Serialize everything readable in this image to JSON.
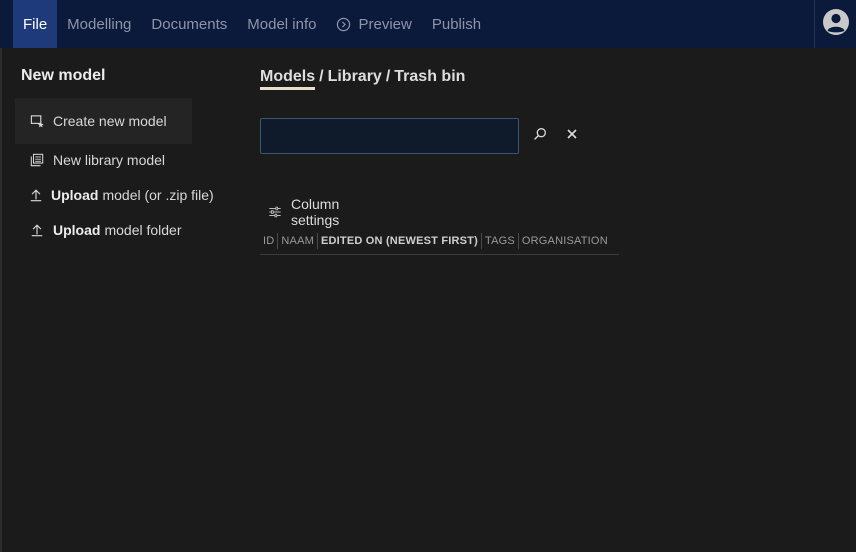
{
  "nav": {
    "items": [
      {
        "label": "File",
        "active": true
      },
      {
        "label": "Modelling"
      },
      {
        "label": "Documents"
      },
      {
        "label": "Model info"
      },
      {
        "label": "Preview",
        "icon": "play-circle-icon"
      },
      {
        "label": "Publish"
      }
    ],
    "user_icon": "user-avatar-icon"
  },
  "sidebar": {
    "title": "New model",
    "items": [
      {
        "bold": "",
        "text": "Create new model",
        "icon": "new-model-icon"
      },
      {
        "bold": "",
        "text": "New library model",
        "icon": "library-icon"
      },
      {
        "bold": "Upload",
        "text": "model (or .zip file)",
        "icon": "upload-icon"
      },
      {
        "bold": "Upload",
        "text": "model folder",
        "icon": "upload-icon"
      }
    ]
  },
  "main": {
    "breadcrumb": {
      "active": "Models",
      "sep": "/",
      "library": "Library",
      "trash": "Trash bin"
    },
    "search": {
      "value": "",
      "placeholder": ""
    },
    "column_settings_label": "Column settings",
    "columns": [
      "ID",
      "NAAM",
      "EDITED ON (NEWEST FIRST)",
      "TAGS",
      "ORGANISATION"
    ]
  },
  "colors": {
    "topbar": "#0b1a3a",
    "active_tab": "#1f3a7a",
    "background": "#1b1b1b",
    "input_bg": "#0f1a2b"
  }
}
